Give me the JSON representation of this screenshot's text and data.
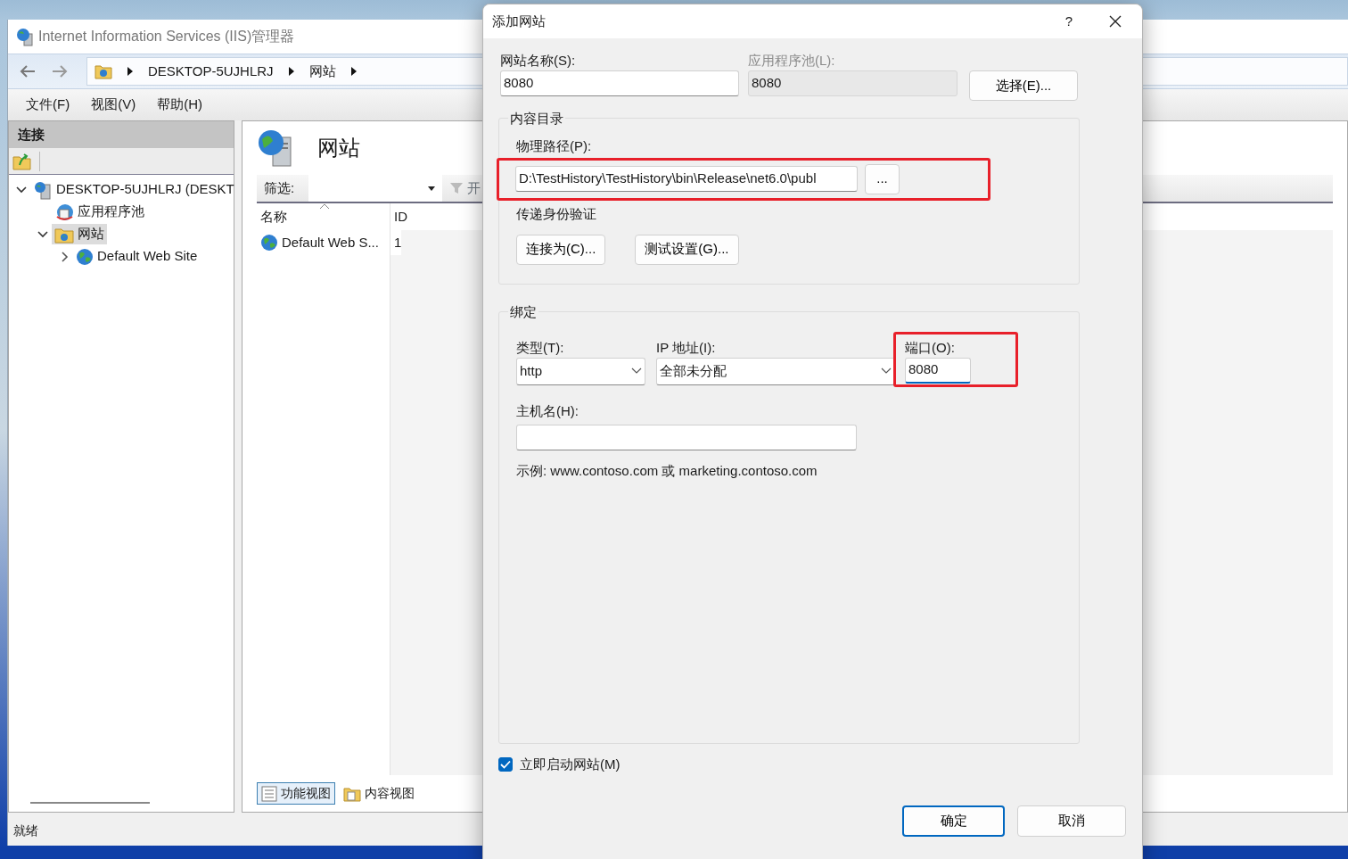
{
  "window": {
    "title": "Internet Information Services (IIS)管理器"
  },
  "breadcrumb": [
    "DESKTOP-5UJHLRJ",
    "网站"
  ],
  "menu": [
    "文件(F)",
    "视图(V)",
    "帮助(H)"
  ],
  "connections": {
    "title": "连接",
    "tree": [
      {
        "label": "DESKTOP-5UJHLRJ (DESKT",
        "kind": "server",
        "expanded": true,
        "selected": false,
        "children": [
          {
            "label": "应用程序池",
            "kind": "pool",
            "selected": false
          },
          {
            "label": "网站",
            "kind": "sites",
            "expanded": true,
            "selected": true,
            "children": [
              {
                "label": "Default Web Site",
                "kind": "site",
                "expanded": false,
                "selected": false
              }
            ]
          }
        ]
      }
    ]
  },
  "page": {
    "title": "网站",
    "filter_label": "筛选:",
    "go_label": "开",
    "columns": [
      "名称",
      "ID"
    ],
    "rows": [
      [
        "Default Web S...",
        "1"
      ]
    ]
  },
  "view_tabs": [
    {
      "label": "功能视图",
      "selected": true,
      "kind": "features"
    },
    {
      "label": "内容视图",
      "selected": false,
      "kind": "content"
    }
  ],
  "status_bar": "就绪",
  "dialog": {
    "title": "添加网站",
    "help": "?",
    "site_name": {
      "label": "网站名称(S):",
      "value": "8080"
    },
    "app_pool": {
      "label": "应用程序池(L):",
      "value": "8080",
      "disabled": true
    },
    "select_button": "选择(E)...",
    "content_directory": {
      "title": "内容目录",
      "path_label": "物理路径(P):",
      "path_value": "D:\\TestHistory\\TestHistory\\bin\\Release\\net6.0\\publ",
      "browse_button": "...",
      "highlighted": true,
      "auth_label": "传递身份验证",
      "buttons": [
        "连接为(C)...",
        "测试设置(G)..."
      ]
    },
    "binding": {
      "title": "绑定",
      "type_label": "类型(T):",
      "type_value": "http",
      "ip_label": "IP 地址(I):",
      "ip_value": "全部未分配",
      "port_label": "端口(O):",
      "port_value": "8080",
      "port_highlighted": true,
      "host_label": "主机名(H):",
      "example": "示例: www.contoso.com 或 marketing.contoso.com"
    },
    "start_now": {
      "label": "立即启动网站(M)",
      "checked": true
    },
    "buttons": [
      {
        "label": "确定",
        "kind": "primary"
      },
      {
        "label": "取消",
        "kind": "secondary"
      }
    ]
  }
}
